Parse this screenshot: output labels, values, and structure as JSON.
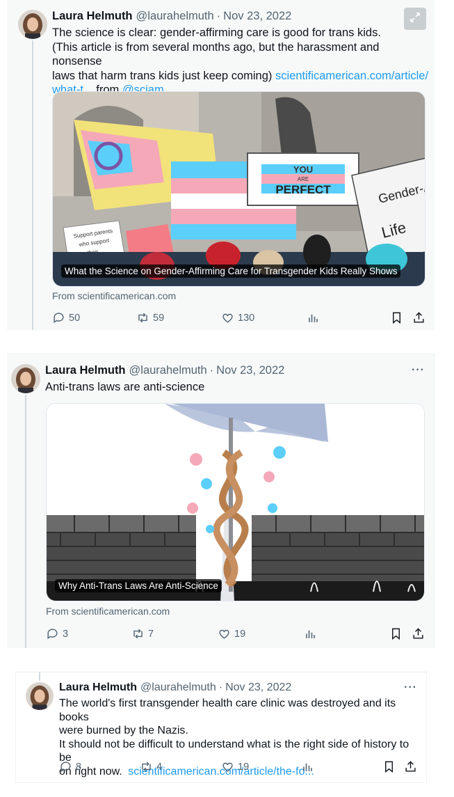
{
  "tweets": [
    {
      "author_name": "Laura Helmuth",
      "author_handle": "@laurahelmuth",
      "separator": "·",
      "date": "Nov 23, 2022",
      "text_line1": "The science is clear: gender-affirming care is good for trans kids.",
      "text_line2": "(This article is from several months ago, but the harassment and nonsense",
      "text_line3": "laws that harm trans kids just keep coming)",
      "link1": "scientificamerican.com/article/",
      "link2": "what-t...",
      "from_word": "from",
      "mention": "@sciam",
      "card_caption": "What the Science on Gender-Affirming Care for Transgender Kids Really Shows",
      "card_source": "From scientificamerican.com",
      "sign_text_top": "YOU",
      "sign_text_mid": "ARE",
      "sign_text_bottom": "PERFECT",
      "sign_parents": "Support parents who support their",
      "sign_gender": "Gender-Af = Life",
      "replies": "50",
      "reposts": "59",
      "likes": "130"
    },
    {
      "author_name": "Laura Helmuth",
      "author_handle": "@laurahelmuth",
      "separator": "·",
      "date": "Nov 23, 2022",
      "text_line1": "Anti-trans laws are anti-science",
      "card_caption": "Why Anti-Trans Laws Are Anti-Science",
      "card_source": "From scientificamerican.com",
      "replies": "3",
      "reposts": "7",
      "likes": "19"
    },
    {
      "author_name": "Laura Helmuth",
      "author_handle": "@laurahelmuth",
      "separator": "·",
      "date": "Nov 23, 2022",
      "text_line1": "The world's first transgender health care clinic was destroyed and its books",
      "text_line2": "were burned by the Nazis.",
      "text_line3": "It should not be difficult to understand what is the right side of history to be",
      "text_line4": "on right now.",
      "link1": "scientificamerican.com/article/the-fo...",
      "replies": "8",
      "reposts": "4",
      "likes": "19"
    }
  ],
  "icons": {
    "reply": "reply-icon",
    "repost": "repost-icon",
    "like": "heart-icon",
    "views": "views-icon",
    "bookmark": "bookmark-icon",
    "share": "share-icon",
    "more": "more-icon",
    "expand": "expand-icon"
  },
  "colors": {
    "link": "#1d9bf0",
    "text": "#0f1419",
    "muted": "#536471",
    "trans_blue": "#5bcefa",
    "trans_pink": "#f5a9b8"
  },
  "more_glyph": "···"
}
